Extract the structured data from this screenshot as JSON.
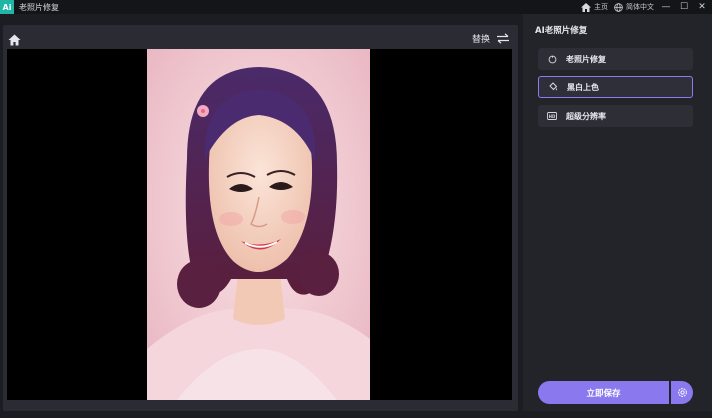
{
  "titlebar": {
    "logo_text": "Ai",
    "title": "老照片修复",
    "home_label": "主页",
    "language_label": "简体中文",
    "minimize": "—",
    "maximize": "☐",
    "close": "✕"
  },
  "preview": {
    "replace_label": "替换"
  },
  "side": {
    "title": "AI老照片修复",
    "features": [
      {
        "label": "老照片修复",
        "icon": "restore-icon"
      },
      {
        "label": "黑白上色",
        "icon": "paint-bucket-icon",
        "active": true
      },
      {
        "label": "超级分辨率",
        "icon": "hd-icon"
      }
    ],
    "save_label": "立即保存"
  },
  "colors": {
    "accent": "#8a78ee",
    "panel": "#2b2c33",
    "background": "#1c1d22"
  }
}
